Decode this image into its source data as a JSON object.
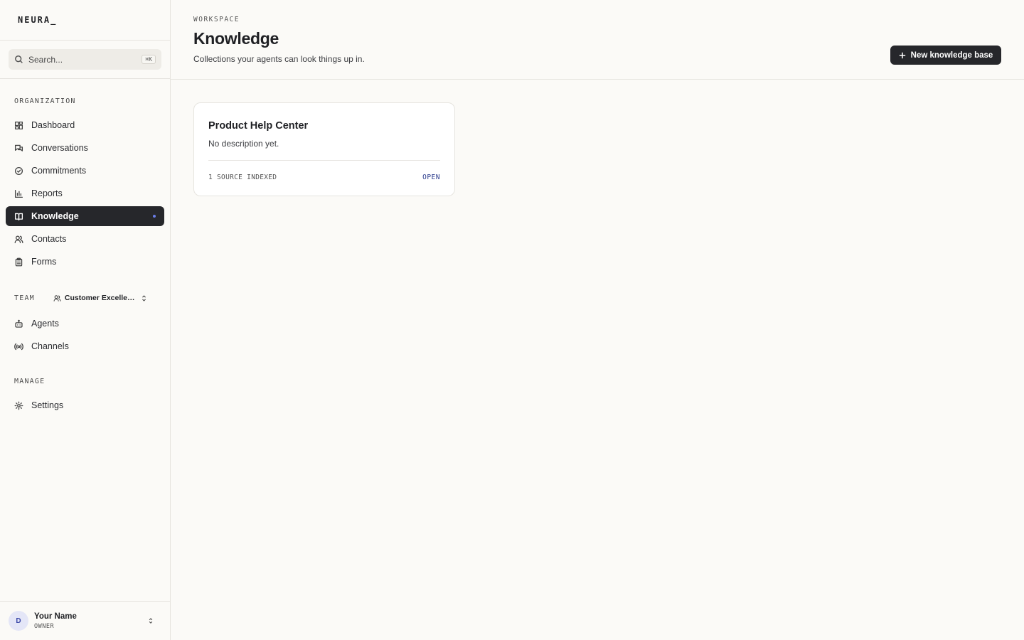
{
  "brand": {
    "name": "NEURA_"
  },
  "search": {
    "placeholder": "Search...",
    "shortcut": "⌘K"
  },
  "sidebar": {
    "sections": {
      "organization": "ORGANIZATION",
      "team": "TEAM",
      "manage": "MANAGE"
    },
    "org_items": [
      {
        "label": "Dashboard",
        "icon": "dashboard-icon"
      },
      {
        "label": "Conversations",
        "icon": "chat-icon"
      },
      {
        "label": "Commitments",
        "icon": "check-circle-icon"
      },
      {
        "label": "Reports",
        "icon": "bar-chart-icon"
      },
      {
        "label": "Knowledge",
        "icon": "book-icon",
        "active": true
      },
      {
        "label": "Contacts",
        "icon": "users-icon"
      },
      {
        "label": "Forms",
        "icon": "clipboard-icon"
      }
    ],
    "team_selector": {
      "name": "Customer Excellenc..."
    },
    "team_items": [
      {
        "label": "Agents",
        "icon": "bot-icon"
      },
      {
        "label": "Channels",
        "icon": "broadcast-icon"
      }
    ],
    "manage_items": [
      {
        "label": "Settings",
        "icon": "gear-icon"
      }
    ]
  },
  "user": {
    "initial": "D",
    "name": "Your Name",
    "role": "OWNER"
  },
  "header": {
    "eyebrow": "WORKSPACE",
    "title": "Knowledge",
    "subtitle": "Collections your agents can look things up in.",
    "new_button": "New knowledge base"
  },
  "cards": [
    {
      "title": "Product Help Center",
      "description": "No description yet.",
      "sources": "1 SOURCE INDEXED",
      "action": "OPEN"
    }
  ],
  "colors": {
    "background": "#fbfaf7",
    "active_nav": "#26272b",
    "accent_dot": "#6a7de8",
    "link": "#2a3a8c"
  }
}
